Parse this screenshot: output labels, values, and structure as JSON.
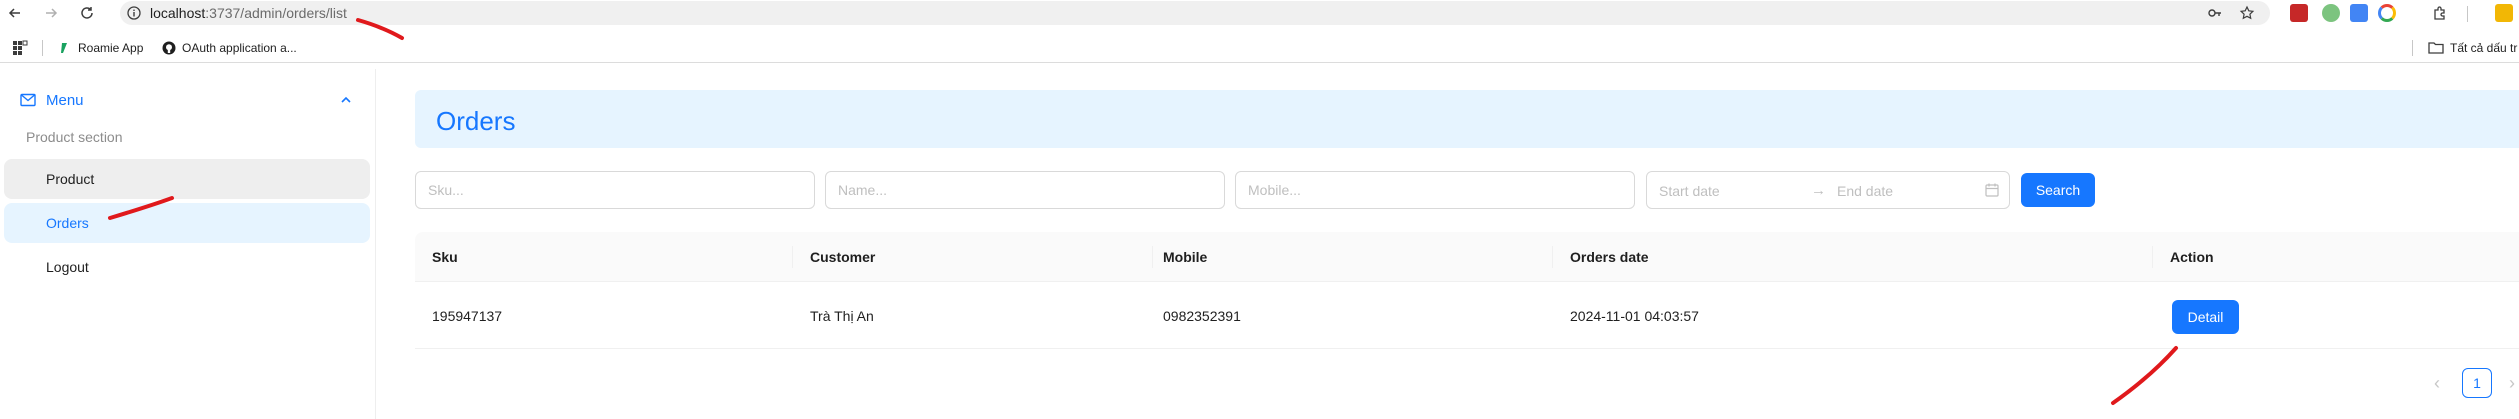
{
  "browser": {
    "url_host": "localhost",
    "url_path": ":3737/admin/orders/list",
    "bookmarks": [
      {
        "label": "Roamie App"
      },
      {
        "label": "OAuth application a..."
      }
    ],
    "bookmarks_folder": "Tất cả dấu tr"
  },
  "sidebar": {
    "menu_label": "Menu",
    "group_title": "Product section",
    "items": [
      {
        "label": "Product"
      },
      {
        "label": "Orders"
      },
      {
        "label": "Logout"
      }
    ]
  },
  "main": {
    "title": "Orders",
    "filters": {
      "sku_placeholder": "Sku...",
      "name_placeholder": "Name...",
      "mobile_placeholder": "Mobile...",
      "start_date_placeholder": "Start date",
      "end_date_placeholder": "End date",
      "search_label": "Search"
    },
    "table": {
      "headers": [
        "Sku",
        "Customer",
        "Mobile",
        "Orders date",
        "Action"
      ],
      "rows": [
        {
          "sku": "195947137",
          "customer": "Trà Thị An",
          "mobile": "0982352391",
          "orders_date": "2024-11-01 04:03:57",
          "action_label": "Detail"
        }
      ]
    },
    "pagination": {
      "current_page": "1",
      "prev_symbol": "‹",
      "next_symbol": "›"
    }
  },
  "colors": {
    "accent": "#1677ff",
    "header_bg": "#e6f4ff",
    "annotation": "#e0191c"
  },
  "icons": [
    "back-icon",
    "forward-icon",
    "reload-icon",
    "info-icon",
    "password-key-icon",
    "star-icon",
    "apps-grid-icon",
    "github-icon",
    "folder-icon",
    "mail-icon",
    "chevron-up-icon",
    "calendar-icon"
  ]
}
